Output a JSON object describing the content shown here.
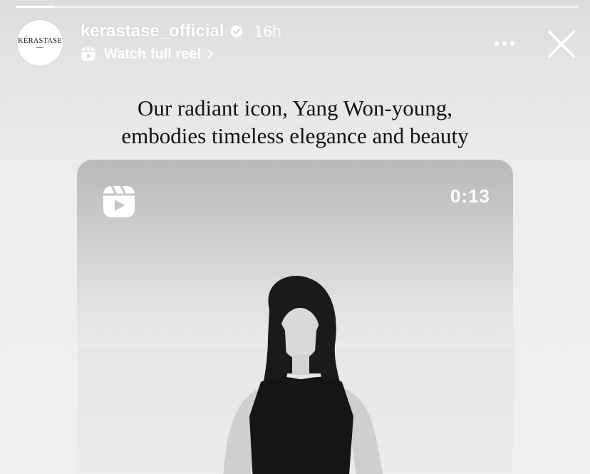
{
  "story": {
    "progress_fraction": 0.07
  },
  "header": {
    "avatar_brand": "KÉRASTASE",
    "username": "kerastase_official",
    "verified_icon": "verified-badge-icon",
    "time_ago": "16h",
    "reel_link": {
      "icon": "reels-icon",
      "label": "Watch full reel",
      "chevron_icon": "chevron-right-icon"
    },
    "more_icon": "more-horizontal-icon",
    "close_icon": "close-icon"
  },
  "caption": {
    "line1": "Our radiant icon, Yang Won-young,",
    "line2": "embodies timeless elegance and beauty"
  },
  "reel_card": {
    "icon": "reels-icon",
    "duration": "0:13"
  },
  "colors": {
    "header_text": "#ffffff",
    "caption_text": "#111111",
    "background": "#ececec"
  }
}
